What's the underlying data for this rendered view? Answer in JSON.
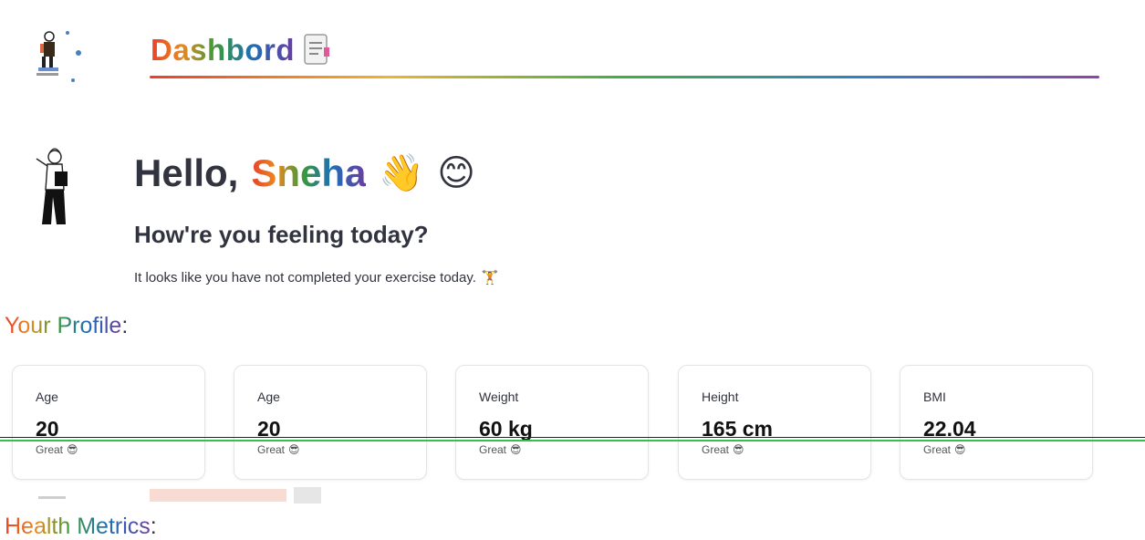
{
  "header": {
    "title": "Dashbord",
    "title_icon": "document-icon"
  },
  "greeting": {
    "hello_prefix": "Hello,",
    "name": "Sneha",
    "emoji_wave": "👋",
    "emoji_smile": "😊",
    "question": "How're you feeling today?",
    "exercise_message": "It looks like you have not completed your exercise today.",
    "exercise_icon": "🏋"
  },
  "profile": {
    "heading": "Your Profile",
    "heading_colon": ":",
    "cards": [
      {
        "label": "Age",
        "value": "20",
        "delta": "Great",
        "emoji": "😎"
      },
      {
        "label": "Age",
        "value": "20",
        "delta": "Great",
        "emoji": "😎"
      },
      {
        "label": "Weight",
        "value": "60 kg",
        "delta": "Great",
        "emoji": "😎"
      },
      {
        "label": "Height",
        "value": "165 cm",
        "delta": "Great",
        "emoji": "😎"
      },
      {
        "label": "BMI",
        "value": "22.04",
        "delta": "Great",
        "emoji": "😎"
      }
    ]
  },
  "health": {
    "heading": "Health Metrics",
    "heading_colon": ":"
  },
  "colors": {
    "text": "#31333f",
    "rainbow_start": "#e8402a",
    "rainbow_end": "#8e44ad",
    "card_border": "#e4e4e7"
  }
}
